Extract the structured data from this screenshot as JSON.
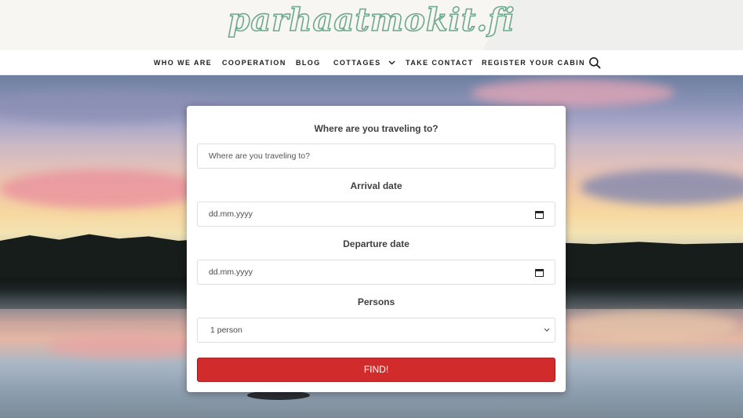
{
  "header": {
    "logo_text": "parhaatmokit.fi"
  },
  "nav": {
    "items": [
      {
        "label": "WHO WE ARE"
      },
      {
        "label": "COOPERATION"
      },
      {
        "label": "BLOG"
      },
      {
        "label": "COTTAGES",
        "has_dropdown": true
      },
      {
        "label": "TAKE CONTACT"
      },
      {
        "label": "REGISTER YOUR CABIN"
      }
    ],
    "search_icon": "search-icon"
  },
  "search_form": {
    "destination_label": "Where are you traveling to?",
    "destination_placeholder": "Where are you traveling to?",
    "arrival_label": "Arrival date",
    "arrival_value": "dd.mm.yyyy",
    "departure_label": "Departure date",
    "departure_value": "dd.mm.yyyy",
    "persons_label": "Persons",
    "persons_selected": "1 person",
    "submit_label": "FIND!"
  },
  "colors": {
    "accent": "#d12b2b",
    "logo": "#6fa98d",
    "header_bg": "#f7f6f3"
  }
}
